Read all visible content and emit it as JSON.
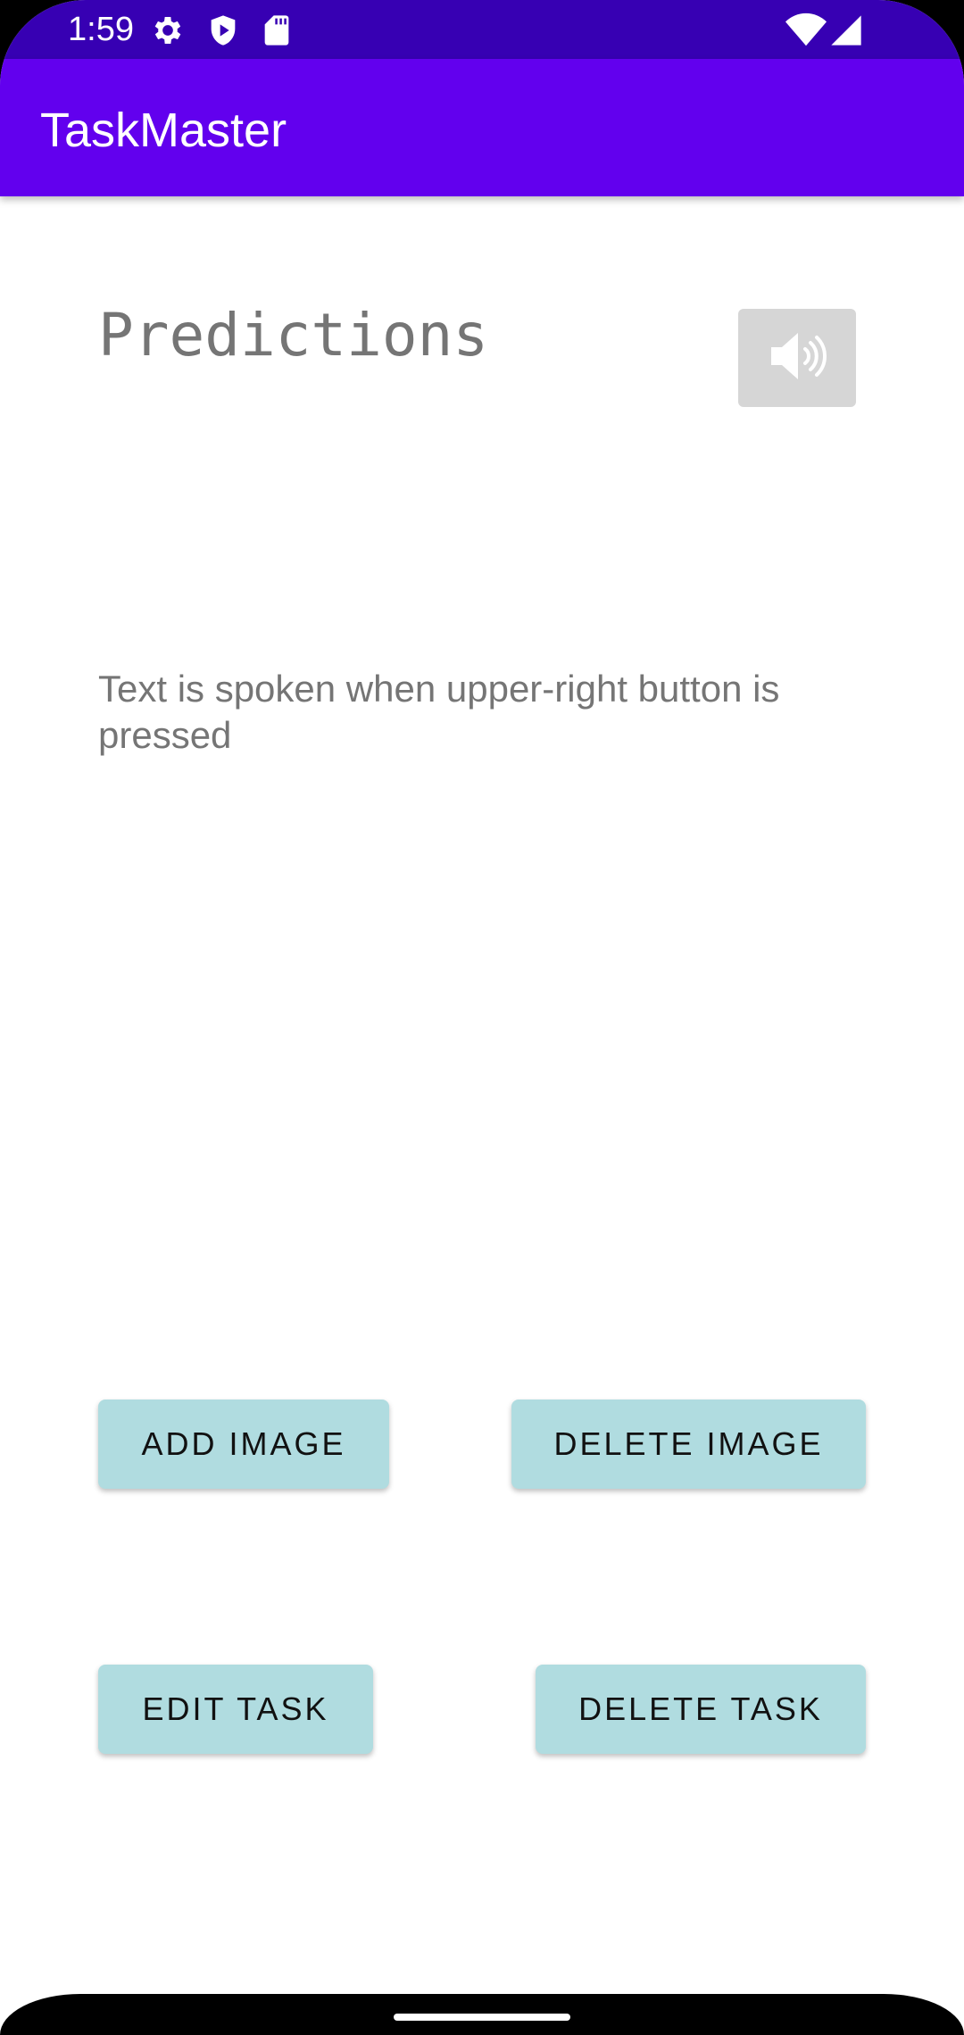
{
  "status_bar": {
    "time": "1:59",
    "icons_left": [
      "settings-icon",
      "shield-play-icon",
      "sd-card-icon"
    ],
    "icons_right": [
      "wifi-icon",
      "cellular-signal-icon"
    ],
    "background": "#3700b3"
  },
  "app_bar": {
    "title": "TaskMaster",
    "background": "#6200ee"
  },
  "content": {
    "predictions_label": "Predictions",
    "speak_button_icon": "speaker-icon",
    "hint": "Text is spoken when upper-right button is pressed"
  },
  "buttons": {
    "add_image": "ADD IMAGE",
    "delete_image": "DELETE IMAGE",
    "edit_task": "EDIT TASK",
    "delete_task": "DELETE TASK",
    "background": "#b0dce0"
  }
}
